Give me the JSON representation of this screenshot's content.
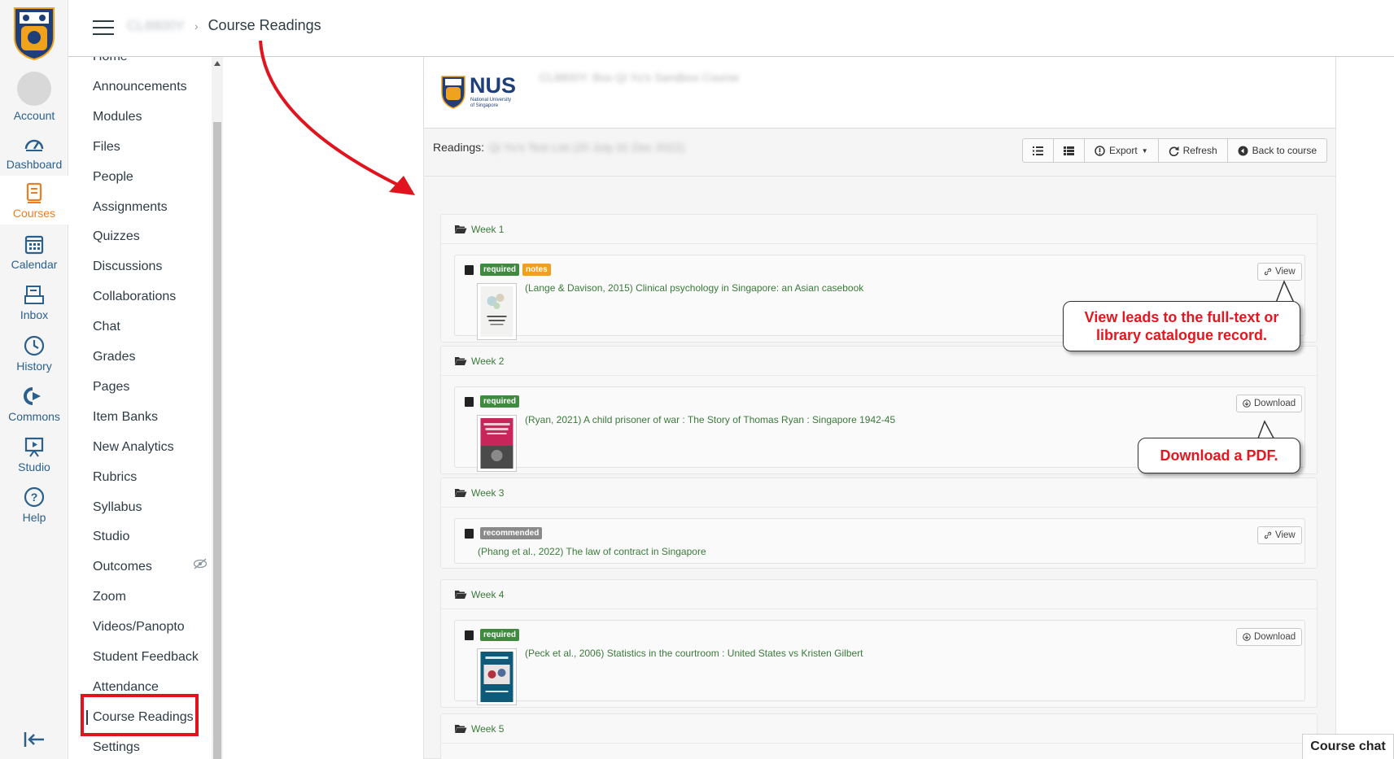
{
  "global_nav": {
    "items": [
      {
        "label": "Account",
        "icon": "account-avatar-icon"
      },
      {
        "label": "Dashboard",
        "icon": "dashboard-icon"
      },
      {
        "label": "Courses",
        "icon": "courses-icon"
      },
      {
        "label": "Calendar",
        "icon": "calendar-icon"
      },
      {
        "label": "Inbox",
        "icon": "inbox-icon"
      },
      {
        "label": "History",
        "icon": "history-icon"
      },
      {
        "label": "Commons",
        "icon": "commons-icon"
      },
      {
        "label": "Studio",
        "icon": "studio-icon"
      },
      {
        "label": "Help",
        "icon": "help-icon"
      }
    ],
    "active": "Courses",
    "accent_color": "#ee7d22",
    "link_color": "#2b5f8c"
  },
  "header": {
    "course_code": "CL8800Y",
    "breadcrumb_current": "Course Readings"
  },
  "course_nav": {
    "items": [
      "Home",
      "Announcements",
      "Modules",
      "Files",
      "People",
      "Assignments",
      "Quizzes",
      "Discussions",
      "Collaborations",
      "Chat",
      "Grades",
      "Pages",
      "Item Banks",
      "New Analytics",
      "Rubrics",
      "Syllabus",
      "Studio",
      "Outcomes",
      "Zoom",
      "Videos/Panopto",
      "Student Feedback",
      "Attendance",
      "Course Readings",
      "Settings"
    ],
    "current": "Course Readings"
  },
  "brand": {
    "logo_text": "NUS",
    "logo_sub1": "National University",
    "logo_sub2": "of Singapore",
    "course_title": "CL8800Y: Box Qi Yu's Sandbox Course"
  },
  "readings_bar": {
    "label": "Readings:",
    "list_name": "Qi Yu's Test List (20 July-31 Dec 2022)",
    "export_label": "Export",
    "refresh_label": "Refresh",
    "back_label": "Back to course"
  },
  "weeks": [
    {
      "title": "Week 1",
      "reading": {
        "badges": [
          "required",
          "notes"
        ],
        "citation": "(Lange & Davison, 2015) Clinical psychology in Singapore: an Asian casebook",
        "action": "View"
      }
    },
    {
      "title": "Week 2",
      "reading": {
        "badges": [
          "required"
        ],
        "citation": "(Ryan, 2021) A child prisoner of war : The Story of Thomas Ryan : Singapore 1942-45",
        "action": "Download"
      }
    },
    {
      "title": "Week 3",
      "reading": {
        "badges": [
          "recommended"
        ],
        "citation": "(Phang et al., 2022) The law of contract in Singapore",
        "action": "View"
      }
    },
    {
      "title": "Week 4",
      "reading": {
        "badges": [
          "required"
        ],
        "citation": "(Peck et al., 2006) Statistics in the courtroom : United States vs Kristen Gilbert",
        "action": "Download"
      }
    },
    {
      "title": "Week 5"
    }
  ],
  "callouts": {
    "view_line1": "View leads to the full-text or",
    "view_line2": "library catalogue record.",
    "download": "Download a PDF."
  },
  "chat_tab": "Course chat",
  "colors": {
    "required": "#3f8a3f",
    "notes": "#f0a020",
    "recommended": "#8a8a8a",
    "callout_text": "#e4161f",
    "highlight_box": "#e0141e"
  }
}
